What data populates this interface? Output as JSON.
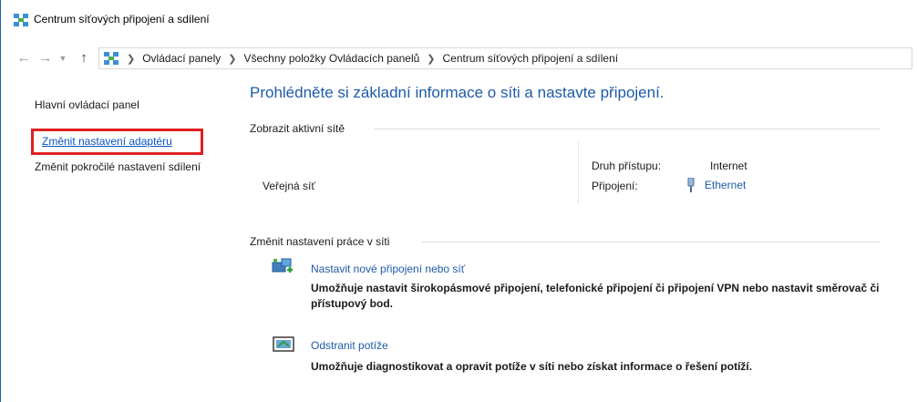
{
  "window": {
    "title": "Centrum síťových připojení a sdílení"
  },
  "navigation": {
    "back_icon": "arrow-left-icon",
    "forward_icon": "arrow-right-icon",
    "recent_icon": "chevron-down-icon",
    "up_icon": "arrow-up-icon",
    "breadcrumbs": [
      "Ovládací panely",
      "Všechny položky Ovládacích panelů",
      "Centrum síťových připojení a sdílení"
    ]
  },
  "sidebar": {
    "home": "Hlavní ovládací panel",
    "change_adapter": "Změnit nastavení adaptéru",
    "advanced_sharing": "Změnit pokročilé nastavení sdílení"
  },
  "main": {
    "title": "Prohlédněte si základní informace o síti a nastavte připojení.",
    "active_networks_header": "Zobrazit aktivní sítě",
    "network_name": "Veřejná síť",
    "access_type_label": "Druh přístupu:",
    "access_type_value": "Internet",
    "connections_label": "Připojení:",
    "connections_value": "Ethernet",
    "change_settings_header": "Změnit nastavení práce v síti",
    "tasks": [
      {
        "link": "Nastavit nové připojení nebo síť",
        "description": "Umožňuje nastavit širokopásmové připojení, telefonické připojení či připojení VPN nebo nastavit směrovač či přístupový bod."
      },
      {
        "link": "Odstranit potíže",
        "description": "Umožňuje diagnostikovat a opravit potíže v síti nebo získat informace o řešení potíží."
      }
    ]
  },
  "colors": {
    "link": "#1e5aa8",
    "highlight": "#e02020"
  }
}
